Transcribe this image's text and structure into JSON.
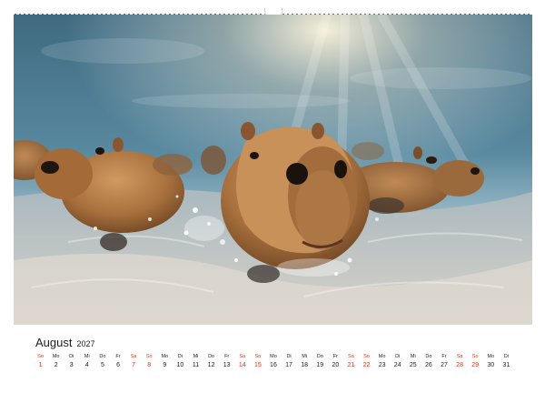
{
  "calendar": {
    "month": "August",
    "year": "2027",
    "weekend_color": "#d43a1f",
    "days": [
      {
        "dow": "So",
        "num": "1",
        "weekend": true
      },
      {
        "dow": "Mo",
        "num": "2",
        "weekend": false
      },
      {
        "dow": "Di",
        "num": "3",
        "weekend": false
      },
      {
        "dow": "Mi",
        "num": "4",
        "weekend": false
      },
      {
        "dow": "Do",
        "num": "5",
        "weekend": false
      },
      {
        "dow": "Fr",
        "num": "6",
        "weekend": false
      },
      {
        "dow": "Sa",
        "num": "7",
        "weekend": true
      },
      {
        "dow": "So",
        "num": "8",
        "weekend": true
      },
      {
        "dow": "Mo",
        "num": "9",
        "weekend": false
      },
      {
        "dow": "Di",
        "num": "10",
        "weekend": false
      },
      {
        "dow": "Mi",
        "num": "11",
        "weekend": false
      },
      {
        "dow": "Do",
        "num": "12",
        "weekend": false
      },
      {
        "dow": "Fr",
        "num": "13",
        "weekend": false
      },
      {
        "dow": "Sa",
        "num": "14",
        "weekend": true
      },
      {
        "dow": "So",
        "num": "15",
        "weekend": true
      },
      {
        "dow": "Mo",
        "num": "16",
        "weekend": false
      },
      {
        "dow": "Di",
        "num": "17",
        "weekend": false
      },
      {
        "dow": "Mi",
        "num": "18",
        "weekend": false
      },
      {
        "dow": "Do",
        "num": "19",
        "weekend": false
      },
      {
        "dow": "Fr",
        "num": "20",
        "weekend": false
      },
      {
        "dow": "Sa",
        "num": "21",
        "weekend": true
      },
      {
        "dow": "So",
        "num": "22",
        "weekend": true
      },
      {
        "dow": "Mo",
        "num": "23",
        "weekend": false
      },
      {
        "dow": "Di",
        "num": "24",
        "weekend": false
      },
      {
        "dow": "Mi",
        "num": "25",
        "weekend": false
      },
      {
        "dow": "Do",
        "num": "26",
        "weekend": false
      },
      {
        "dow": "Fr",
        "num": "27",
        "weekend": false
      },
      {
        "dow": "Sa",
        "num": "28",
        "weekend": true
      },
      {
        "dow": "So",
        "num": "29",
        "weekend": true
      },
      {
        "dow": "Mo",
        "num": "30",
        "weekend": false
      },
      {
        "dow": "Di",
        "num": "31",
        "weekend": false
      }
    ]
  },
  "photo": {
    "subject": "capybaras-swimming-underwater",
    "water_color": "#4f7f96",
    "fur_color": "#b47d48",
    "sand_color": "#c9c4bd"
  }
}
